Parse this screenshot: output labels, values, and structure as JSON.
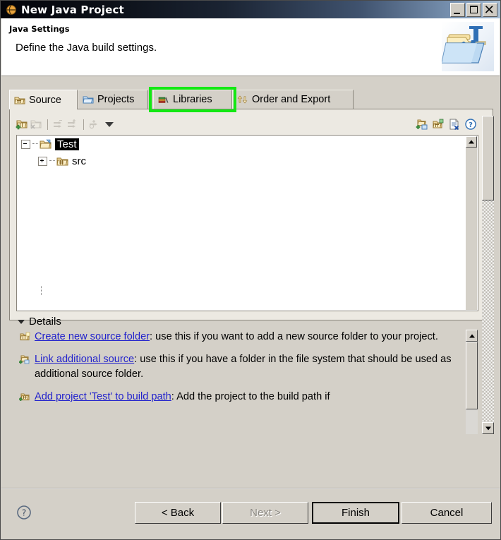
{
  "window": {
    "title": "New Java Project",
    "icon": "java-project-icon",
    "controls": [
      {
        "name": "minimize-button",
        "glyph": "_"
      },
      {
        "name": "maximize-button",
        "glyph": "□"
      },
      {
        "name": "close-button",
        "glyph": "✕"
      }
    ]
  },
  "banner": {
    "subtitle": "Java Settings",
    "description": "Define the Java build settings.",
    "icon": "java-folder-wizard-icon"
  },
  "tabs": [
    {
      "label": "Source",
      "icon": "source-folder-icon",
      "active": true,
      "highlighted": false
    },
    {
      "label": "Projects",
      "icon": "projects-folder-icon",
      "active": false,
      "highlighted": false
    },
    {
      "label": "Libraries",
      "icon": "libraries-books-icon",
      "active": false,
      "highlighted": true
    },
    {
      "label": "Order and Export",
      "icon": "order-export-arrows-icon",
      "active": false,
      "highlighted": false
    }
  ],
  "toolbar": {
    "left": [
      {
        "name": "add-source-folder-icon",
        "enabled": true
      },
      {
        "name": "remove-source-folder-icon",
        "enabled": false
      },
      {
        "name": "link-source-in-icon",
        "enabled": false
      },
      {
        "name": "link-source-out-icon",
        "enabled": false
      },
      {
        "name": "configure-filters-icon",
        "enabled": false
      }
    ],
    "dropdown": "toolbar-menu-caret",
    "right": [
      {
        "name": "link-additional-source-icon"
      },
      {
        "name": "add-project-to-build-path-icon"
      },
      {
        "name": "remove-from-build-path-icon"
      },
      {
        "name": "help-hint-icon"
      }
    ]
  },
  "tree": {
    "nodes": [
      {
        "label": "Test",
        "icon": "project-folder-icon",
        "expander": "minus",
        "selected": true,
        "indent": 0
      },
      {
        "label": "src",
        "icon": "source-package-folder-icon",
        "expander": "plus",
        "selected": false,
        "indent": 1
      }
    ]
  },
  "details": {
    "title": "Details",
    "expanded": true,
    "items": [
      {
        "icon": "create-new-source-folder-icon",
        "link": "Create new source folder",
        "text": ": use this if you want to add a new source folder to your project."
      },
      {
        "icon": "link-additional-source-icon",
        "link": "Link additional source",
        "text": ": use this if you have a folder in the file system that should be used as additional source folder."
      },
      {
        "icon": "add-project-to-build-path-icon",
        "link": "Add project 'Test' to build path",
        "text": ": Add the project to the build path if"
      }
    ]
  },
  "footer": {
    "help": "help-button",
    "buttons": [
      {
        "label": "< Back",
        "name": "back-button",
        "enabled": true,
        "default": false
      },
      {
        "label": "Next >",
        "name": "next-button",
        "enabled": false,
        "default": false
      },
      {
        "label": "Finish",
        "name": "finish-button",
        "enabled": true,
        "default": true
      },
      {
        "label": "Cancel",
        "name": "cancel-button",
        "enabled": true,
        "default": false
      }
    ]
  },
  "colors": {
    "highlight_green": "#13e813",
    "link_blue": "#2222cc",
    "dialog_bg": "#d4d0c8",
    "tab_body_bg": "#ece9e2",
    "titlebar_dark": "#04050a"
  }
}
